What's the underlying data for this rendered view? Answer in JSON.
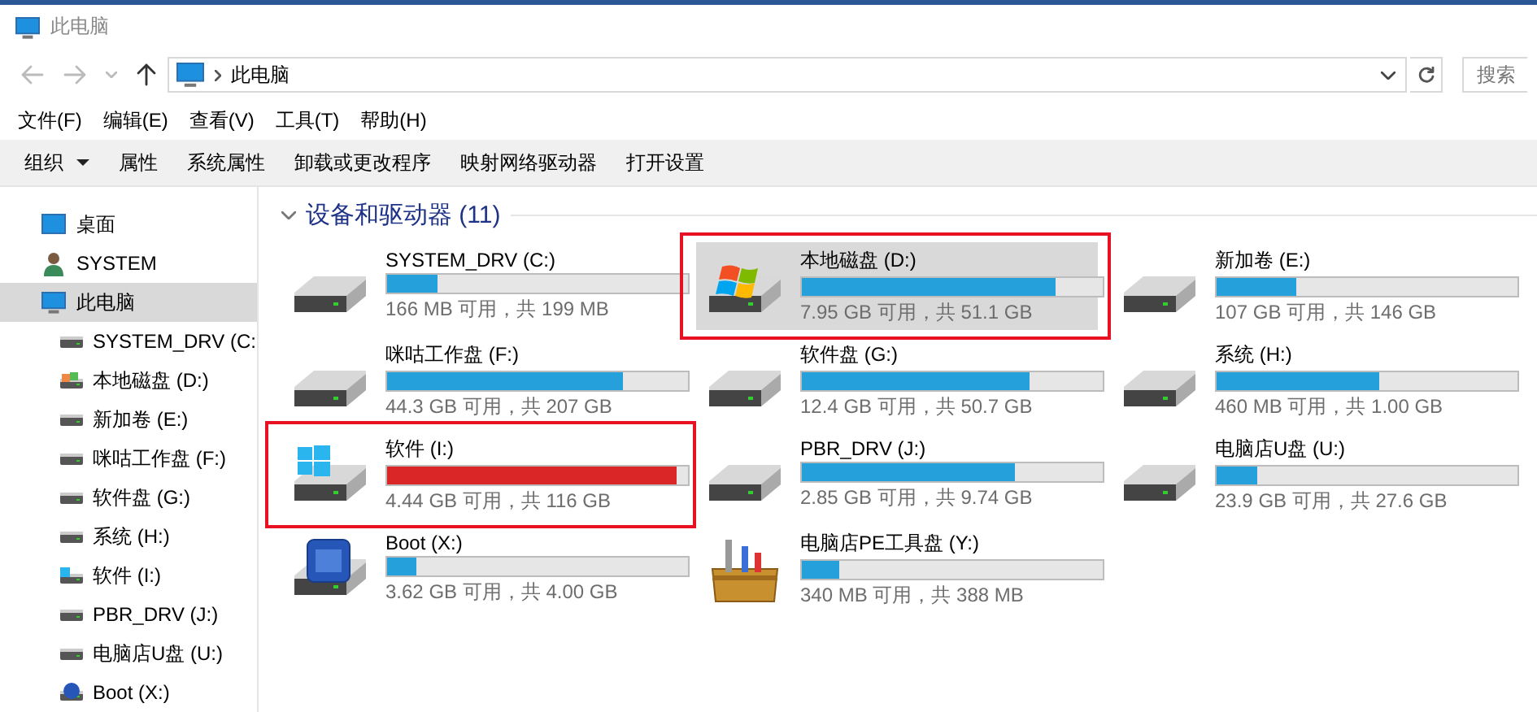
{
  "window": {
    "title": "此电脑"
  },
  "nav": {
    "path": "此电脑",
    "search_placeholder": "搜索"
  },
  "menu": [
    "文件(F)",
    "编辑(E)",
    "查看(V)",
    "工具(T)",
    "帮助(H)"
  ],
  "toolbar": [
    {
      "label": "组织",
      "dropdown": true
    },
    {
      "label": "属性",
      "dropdown": false
    },
    {
      "label": "系统属性",
      "dropdown": false
    },
    {
      "label": "卸载或更改程序",
      "dropdown": false
    },
    {
      "label": "映射网络驱动器",
      "dropdown": false
    },
    {
      "label": "打开设置",
      "dropdown": false
    }
  ],
  "sidebar": {
    "items": [
      {
        "label": "桌面",
        "kind": "desktop",
        "selected": false
      },
      {
        "label": "SYSTEM",
        "kind": "user",
        "selected": false
      },
      {
        "label": "此电脑",
        "kind": "computer",
        "selected": true,
        "children": [
          {
            "label": "SYSTEM_DRV (C:",
            "kind": "drive",
            "selected": false
          },
          {
            "label": "本地磁盘 (D:)",
            "kind": "windrive",
            "selected": false
          },
          {
            "label": "新加卷 (E:)",
            "kind": "drive",
            "selected": false
          },
          {
            "label": "咪咕工作盘 (F:)",
            "kind": "drive",
            "selected": false
          },
          {
            "label": "软件盘 (G:)",
            "kind": "drive",
            "selected": false
          },
          {
            "label": "系统 (H:)",
            "kind": "drive",
            "selected": false
          },
          {
            "label": "软件 (I:)",
            "kind": "win10drive",
            "selected": false
          },
          {
            "label": "PBR_DRV (J:)",
            "kind": "drive",
            "selected": false
          },
          {
            "label": "电脑店U盘 (U:)",
            "kind": "drive",
            "selected": false
          },
          {
            "label": "Boot (X:)",
            "kind": "boot",
            "selected": false
          }
        ]
      }
    ]
  },
  "section": {
    "title": "设备和驱动器 (11)",
    "expanded": true
  },
  "drives": [
    {
      "name": "SYSTEM_DRV (C:)",
      "usage": "166 MB 可用，共 199 MB",
      "level": 0.166,
      "kind": "drive",
      "selected": false,
      "critical": false,
      "marked": false
    },
    {
      "name": "本地磁盘 (D:)",
      "usage": "7.95 GB 可用，共 51.1 GB",
      "level": 0.844,
      "kind": "windrive",
      "selected": true,
      "critical": false,
      "marked": true
    },
    {
      "name": "新加卷 (E:)",
      "usage": "107 GB 可用，共 146 GB",
      "level": 0.267,
      "kind": "drive",
      "selected": false,
      "critical": false,
      "marked": false
    },
    {
      "name": "咪咕工作盘 (F:)",
      "usage": "44.3 GB 可用，共 207 GB",
      "level": 0.786,
      "kind": "drive",
      "selected": false,
      "critical": false,
      "marked": false
    },
    {
      "name": "软件盘 (G:)",
      "usage": "12.4 GB 可用，共 50.7 GB",
      "level": 0.755,
      "kind": "drive",
      "selected": false,
      "critical": false,
      "marked": false
    },
    {
      "name": "系统 (H:)",
      "usage": "460 MB 可用，共 1.00 GB",
      "level": 0.54,
      "kind": "drive",
      "selected": false,
      "critical": false,
      "marked": false
    },
    {
      "name": "软件 (I:)",
      "usage": "4.44 GB 可用，共 116 GB",
      "level": 0.962,
      "kind": "win10drive",
      "selected": false,
      "critical": true,
      "marked": true
    },
    {
      "name": "PBR_DRV (J:)",
      "usage": "2.85 GB 可用，共 9.74 GB",
      "level": 0.707,
      "kind": "drive",
      "selected": false,
      "critical": false,
      "marked": false
    },
    {
      "name": "电脑店U盘 (U:)",
      "usage": "23.9 GB 可用，共 27.6 GB",
      "level": 0.134,
      "kind": "drive",
      "selected": false,
      "critical": false,
      "marked": false
    },
    {
      "name": "Boot (X:)",
      "usage": "3.62 GB 可用，共 4.00 GB",
      "level": 0.095,
      "kind": "boot",
      "selected": false,
      "critical": false,
      "marked": false
    },
    {
      "name": "电脑店PE工具盘 (Y:)",
      "usage": "340 MB 可用，共 388 MB",
      "level": 0.124,
      "kind": "toolbox",
      "selected": false,
      "critical": false,
      "marked": false
    }
  ]
}
